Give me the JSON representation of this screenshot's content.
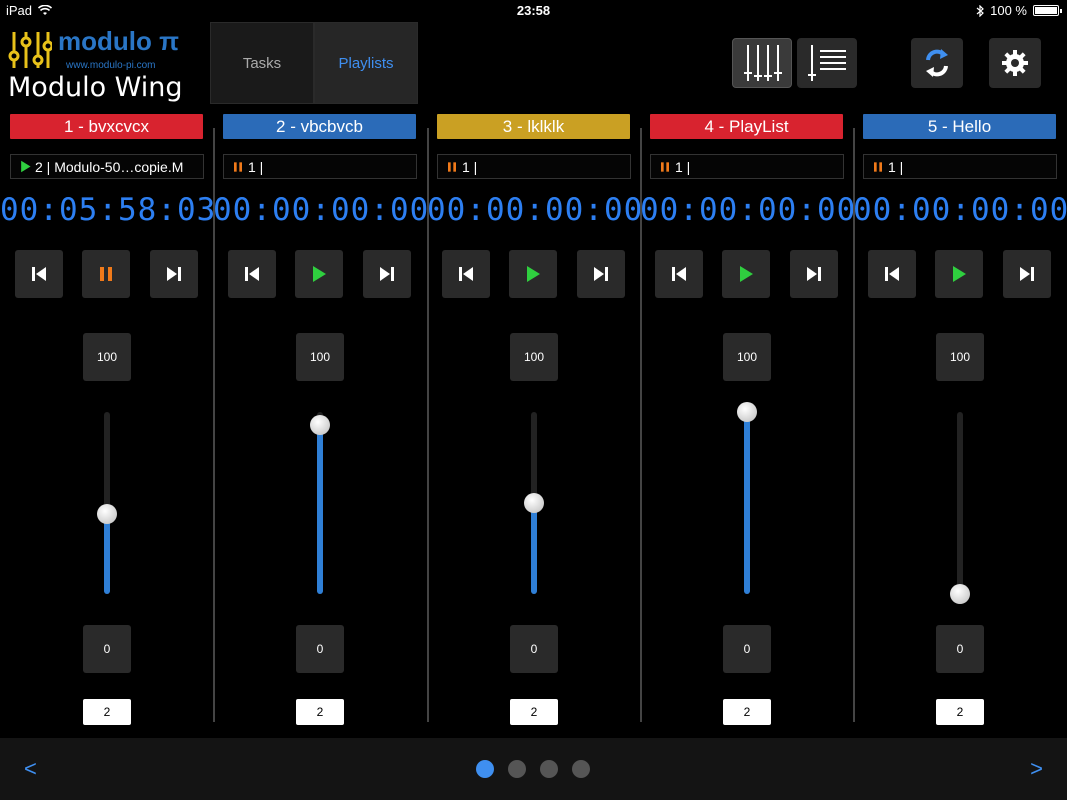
{
  "status_bar": {
    "device": "iPad",
    "time": "23:58",
    "battery": "100 %"
  },
  "header": {
    "brand": "modulo π",
    "url": "www.modulo-pi.com",
    "app_title": "Modulo Wing",
    "tabs": [
      {
        "label": "Tasks",
        "active": false
      },
      {
        "label": "Playlists",
        "active": true
      }
    ],
    "buttons": [
      "mixer-icon",
      "list-icon",
      "sync-icon",
      "gear-icon"
    ]
  },
  "channels": [
    {
      "title": "1 - bvxcvcx",
      "color": "#d8232f",
      "status_icon": "play",
      "status_text": "2 |   Modulo-50…copie.M",
      "timecode": "00:05:58:03",
      "transport_state": "pause",
      "level_max": "100",
      "level_min": "0",
      "level": 0.44,
      "count": "2"
    },
    {
      "title": "2 - vbcbvcb",
      "color": "#2b6bb8",
      "status_icon": "pause",
      "status_text": "1 |",
      "timecode": "00:00:00:00",
      "transport_state": "play",
      "level_max": "100",
      "level_min": "0",
      "level": 0.93,
      "count": "2"
    },
    {
      "title": "3 - lklklk",
      "color": "#caa023",
      "status_icon": "pause",
      "status_text": "1 |",
      "timecode": "00:00:00:00",
      "transport_state": "play",
      "level_max": "100",
      "level_min": "0",
      "level": 0.5,
      "count": "2"
    },
    {
      "title": "4 - PlayList",
      "color": "#d8232f",
      "status_icon": "pause",
      "status_text": "1 |",
      "timecode": "00:00:00:00",
      "transport_state": "play",
      "level_max": "100",
      "level_min": "0",
      "level": 1.0,
      "count": "2"
    },
    {
      "title": "5 - Hello",
      "color": "#2b6bb8",
      "status_icon": "pause",
      "status_text": "1 |",
      "timecode": "00:00:00:00",
      "transport_state": "play",
      "level_max": "100",
      "level_min": "0",
      "level": 0.0,
      "count": "2"
    }
  ],
  "footer": {
    "prev": "<",
    "next": ">",
    "pages": 4,
    "current_page": 1
  },
  "colors": {
    "accent": "#3f8ff0",
    "timecode": "#2d7ff2",
    "play_green": "#2fcf3f",
    "pause_orange": "#f07a1a",
    "slider_fill": "#2f7fd6"
  }
}
